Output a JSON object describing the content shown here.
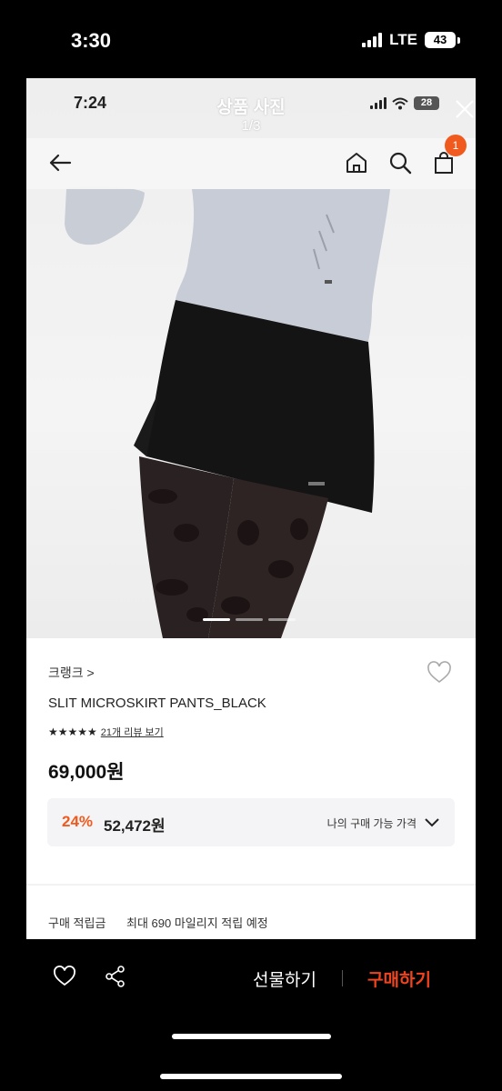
{
  "outer_status": {
    "time": "3:30",
    "network": "LTE",
    "battery": "43"
  },
  "inner_status": {
    "time": "7:24",
    "battery": "28"
  },
  "viewer": {
    "title": "상품 사진",
    "page": "1/3"
  },
  "app_bar": {
    "cart_count": "1"
  },
  "photo": {
    "current_index": 1,
    "total": 3
  },
  "product": {
    "brand": "크랭크 >",
    "name": "SLIT MICROSKIRT PANTS_BLACK",
    "stars": "★★★★★",
    "review_link": "21개 리뷰 보기",
    "price": "69,000원",
    "discount_rate": "24%",
    "discount_price": "52,472원",
    "my_price_label": "나의 구매 가능 가격"
  },
  "points": {
    "label": "구매 적립금",
    "value": "최대 690 마일리지 적립 예정"
  },
  "bottom_bar": {
    "gift_label": "선물하기",
    "buy_label": "구매하기"
  },
  "colors": {
    "accent": "#f05a1e",
    "buy": "#f0431e"
  }
}
